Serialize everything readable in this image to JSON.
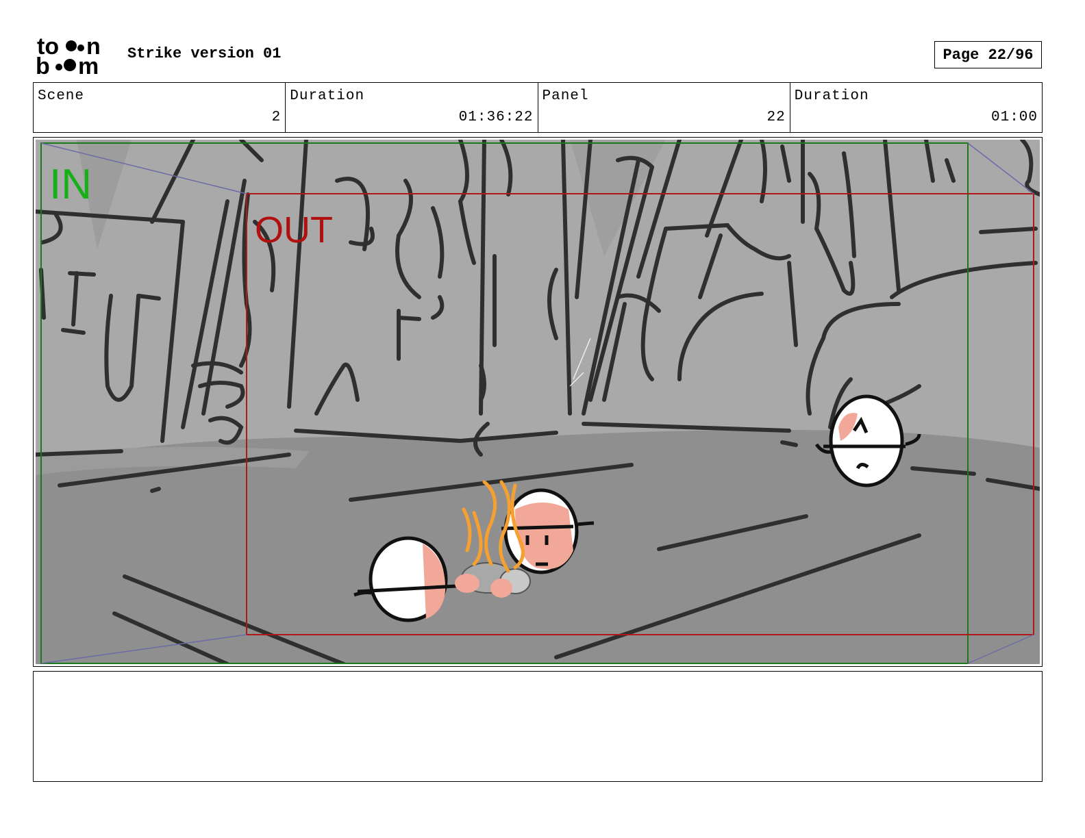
{
  "header": {
    "logo_text": [
      "to",
      "n",
      "b",
      "m"
    ],
    "title": "Strike version 01",
    "page_label": "Page 22/96"
  },
  "info": {
    "scene_label": "Scene",
    "scene_value": "2",
    "scene_duration_label": "Duration",
    "scene_duration_value": "01:36:22",
    "panel_label": "Panel",
    "panel_value": "22",
    "panel_duration_label": "Duration",
    "panel_duration_value": "01:00"
  },
  "panel": {
    "in_label": "IN",
    "out_label": "OUT",
    "colors": {
      "in_frame": "#1a7a1a",
      "in_text": "#18b018",
      "out_frame": "#b01818",
      "out_text": "#b01010",
      "flames": "#f5a030",
      "skin": "#f2a898",
      "background": "#a9a9a9",
      "ground": "#8f8f8f"
    }
  },
  "notes": {
    "text": ""
  }
}
